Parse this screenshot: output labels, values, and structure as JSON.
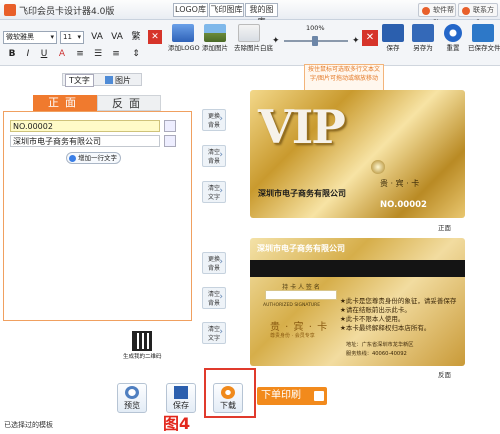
{
  "window": {
    "title": "飞印会员卡设计器4.0版"
  },
  "top_tabs": [
    "LOGO库",
    "飞印图库",
    "我的图库"
  ],
  "header_buttons": {
    "help": "软件帮助",
    "contact": "联系方式"
  },
  "toolbar": {
    "font_name": "微软雅黑",
    "font_size": "11",
    "format_buttons": [
      "VA",
      "VA",
      "繁",
      "B",
      "I",
      "U",
      "A",
      "",
      "",
      ""
    ],
    "zoom": "100%",
    "tools": [
      {
        "label": "添加LOGO",
        "icon": "logo-icon"
      },
      {
        "label": "添加图片",
        "icon": "image-icon"
      },
      {
        "label": "去除图片白底",
        "icon": "eraser-icon"
      },
      {
        "label": "保存",
        "icon": "save-icon"
      },
      {
        "label": "另存为",
        "icon": "save-as-icon"
      },
      {
        "label": "重置",
        "icon": "reset-icon"
      },
      {
        "label": "已保存文件",
        "icon": "folder-icon"
      }
    ]
  },
  "note": "按住鼠标可选取多行文本文字/图片可拖动或缩放移动",
  "panel": {
    "text_tab": "T文字",
    "pic_tab": "图片",
    "front_tab": "正面",
    "back_tab": "反面",
    "fields": [
      "NO.00002",
      "深圳市电子商务有限公司"
    ],
    "add_line": "增加一行文字",
    "qr_label": "生成我的二维码"
  },
  "side_buttons": [
    [
      "更换",
      "背景"
    ],
    [
      "清空",
      "背景"
    ],
    [
      "清空",
      "文字"
    ],
    [
      "更换",
      "背景"
    ],
    [
      "清空",
      "背景"
    ],
    [
      "清空",
      "文字"
    ]
  ],
  "card_front": {
    "vip": "VIP",
    "company": "深圳市电子商务有限公司",
    "vip_cn": "贵 · 宾 · 卡",
    "number": "NO.00002",
    "caption": "正面"
  },
  "card_back": {
    "company": "深圳市电子商务有限公司",
    "sig_label": "持 卡 人 签 名",
    "sig_en": "AUTHORIZED SIGNATURE",
    "vip_cn": "贵 · 宾 · 卡",
    "vip_sub": "尊贵身份  ·  会员专享",
    "rules": [
      "★此卡是您尊贵身份的象征，请妥善保存",
      "★请在结账前出示此卡。",
      "★此卡不限本人使用。",
      "★本卡最终解释权归本店所有。"
    ],
    "address": "地址：广东省深圳市龙华新区",
    "phone": "服务热线：40060-40092",
    "caption": "反面"
  },
  "bottom_buttons": {
    "preview": "预览",
    "save": "保存",
    "download": "下载",
    "print": "下单印刷"
  },
  "figure_label": "图4",
  "status": "已选择过的模板"
}
